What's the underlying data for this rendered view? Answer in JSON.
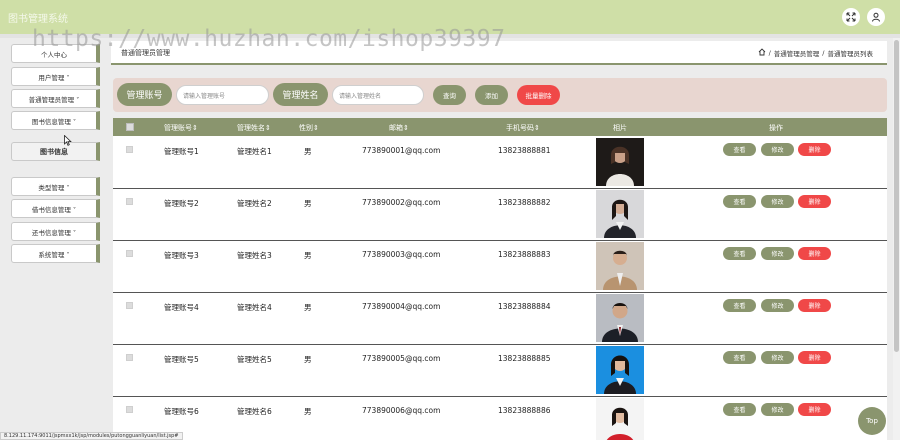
{
  "app": {
    "title": "图书管理系统"
  },
  "header": {
    "fullscreen_icon": "fullscreen-icon",
    "user_icon": "user-icon"
  },
  "watermark": "https://www.huzhan.com/ishop39397",
  "sidebar": {
    "items": [
      {
        "label": "个人中心"
      },
      {
        "label": "用户管理 ˅"
      },
      {
        "label": "普通管理员管理 ˅"
      },
      {
        "label": "图书信息管理 ˅"
      },
      {
        "label": "图书信息"
      },
      {
        "label": "类型管理 ˅"
      },
      {
        "label": "借书信息管理 ˅"
      },
      {
        "label": "还书信息管理 ˅"
      },
      {
        "label": "系统管理 ˅"
      }
    ]
  },
  "breadcrumb": {
    "title": "普通管理员管理",
    "home_icon": "home-icon",
    "sep": "/",
    "level1": "普通管理员管理",
    "level2": "普通管理员列表"
  },
  "search": {
    "account_label": "管理账号",
    "account_placeholder": "请输入管理账号",
    "name_label": "管理姓名",
    "name_placeholder": "请输入管理姓名",
    "query_button": "查询",
    "add_button": "添加",
    "batch_delete_button": "批量删除"
  },
  "table": {
    "headers": [
      "管理账号",
      "管理姓名",
      "性别",
      "邮箱",
      "手机号码",
      "相片",
      "操作"
    ],
    "rows": [
      {
        "account": "管理账号1",
        "name": "管理姓名1",
        "gender": "男",
        "email": "773890001@qq.com",
        "phone": "13823888881"
      },
      {
        "account": "管理账号2",
        "name": "管理姓名2",
        "gender": "男",
        "email": "773890002@qq.com",
        "phone": "13823888882"
      },
      {
        "account": "管理账号3",
        "name": "管理姓名3",
        "gender": "男",
        "email": "773890003@qq.com",
        "phone": "13823888883"
      },
      {
        "account": "管理账号4",
        "name": "管理姓名4",
        "gender": "男",
        "email": "773890004@qq.com",
        "phone": "13823888884"
      },
      {
        "account": "管理账号5",
        "name": "管理姓名5",
        "gender": "男",
        "email": "773890005@qq.com",
        "phone": "13823888885"
      },
      {
        "account": "管理账号6",
        "name": "管理姓名6",
        "gender": "男",
        "email": "773890006@qq.com",
        "phone": "13823888886"
      }
    ],
    "view_label": "查看",
    "edit_label": "修改",
    "delete_label": "删除"
  },
  "top_button": "Top",
  "status_url": "8.129.11.174:9011/jspmxx1k/jsp/modules/putongguanliyuan/list.jsp#",
  "colors": {
    "accent": "#8a956e",
    "header": "#cfdfa7",
    "danger": "#f04848",
    "search_bg": "#e8d6d0"
  }
}
